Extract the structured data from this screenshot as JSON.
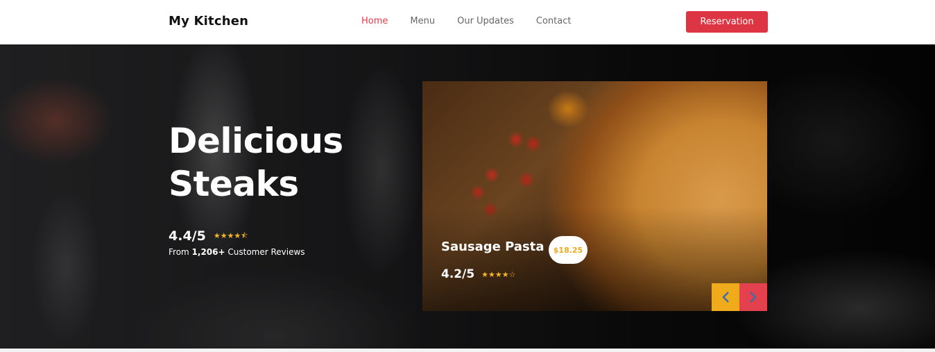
{
  "nav": {
    "brand": "My Kitchen",
    "links": [
      "Home",
      "Menu",
      "Our Updates",
      "Contact"
    ],
    "active_link": "Home",
    "cta_label": "Reservation"
  },
  "hero": {
    "title": "Delicious\nSteaks",
    "rating": "4.4/5",
    "rating_value": 4.4,
    "reviews_prefix": "From ",
    "reviews_count": "1,206+",
    "reviews_suffix": " Customer Reviews"
  },
  "card": {
    "dish_name": "Sausage Pasta",
    "price": "$18.25",
    "rating": "4.2/5",
    "rating_value": 4.2,
    "prev_icon": "chevron-left-icon",
    "next_icon": "chevron-right-icon"
  },
  "colors": {
    "accent_red": "#de3544",
    "star_gold": "#f5b824",
    "arrow_prev": "#f0ab1d",
    "arrow_next": "#e4414f"
  }
}
